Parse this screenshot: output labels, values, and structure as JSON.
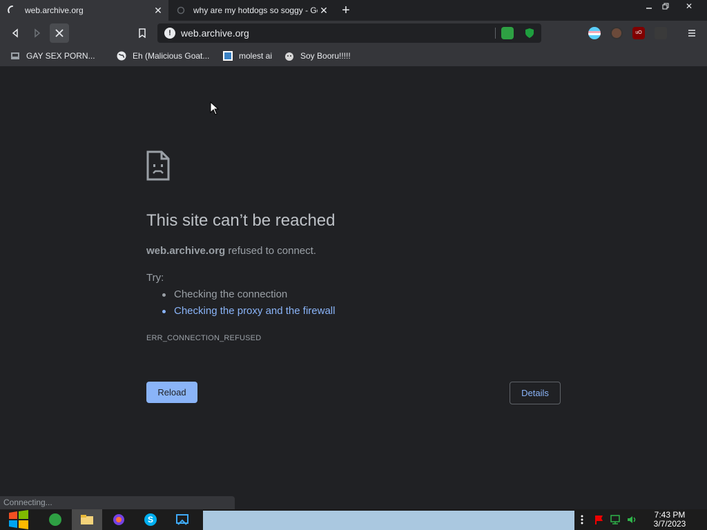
{
  "tabs": [
    {
      "title": "web.archive.org",
      "active": true,
      "loading": true
    },
    {
      "title": "why are my hotdogs so soggy - Go",
      "active": false
    }
  ],
  "toolbar": {
    "url": "web.archive.org"
  },
  "bookmarks": [
    {
      "label": "GAY SEX PORN..."
    },
    {
      "label": "Eh (Malicious Goat..."
    },
    {
      "label": "molest ai"
    },
    {
      "label": "Soy Booru!!!!!"
    }
  ],
  "error": {
    "heading": "This site can’t be reached",
    "host": "web.archive.org",
    "message": " refused to connect.",
    "try_label": "Try:",
    "suggestions": [
      {
        "text": "Checking the connection",
        "link": false
      },
      {
        "text": "Checking the proxy and the firewall",
        "link": true
      }
    ],
    "code": "ERR_CONNECTION_REFUSED",
    "reload_label": "Reload",
    "details_label": "Details"
  },
  "status_text": "Connecting...",
  "clock": {
    "time": "7:43 PM",
    "date": "3/7/2023"
  },
  "colors": {
    "page_bg": "#202124",
    "toolbar_bg": "#35363a",
    "accent": "#8ab4f8",
    "taskbar_bg": "#1c1c1c"
  }
}
